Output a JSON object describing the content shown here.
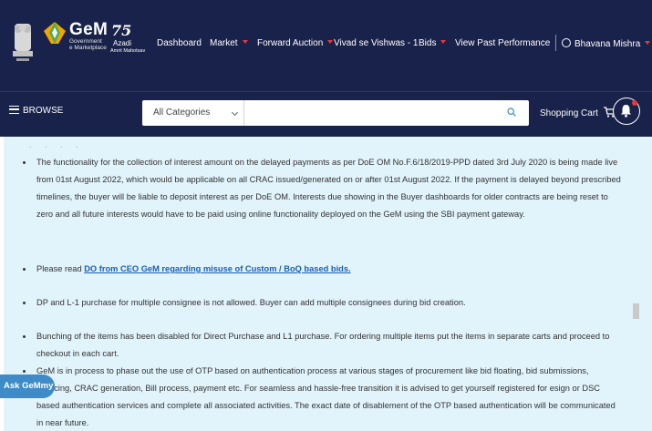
{
  "header": {
    "logo_text": "GeM",
    "logo_subtext_1": "Government",
    "logo_subtext_2": "e Marketplace",
    "azadi_number": "75",
    "azadi_word": "Azadi",
    "azadi_sub": "Amrit Mahotsav",
    "nav": [
      {
        "label": "Dashboard",
        "dropdown": false
      },
      {
        "label": "Market",
        "dropdown": true
      },
      {
        "label": "Forward Auction",
        "dropdown": true
      },
      {
        "label": "Vivad se Vishwas - 1",
        "dropdown": false
      },
      {
        "label": "Bids",
        "dropdown": true
      },
      {
        "label": "View Past Performance",
        "dropdown": false
      }
    ],
    "user_name": "Bhavana Mishra",
    "accent_color": "#e53935",
    "bg_color": "#19224a"
  },
  "toolbar": {
    "browse_label": "BROWSE",
    "category_selected": "All Categories",
    "search_value": "",
    "cart_label": "Shopping Cart"
  },
  "content": {
    "bullets": [
      {
        "text": "The functionality for the collection of interest amount on the delayed payments as per DoE OM No.F.6/18/2019-PPD dated 3rd July 2020 is being made live from 01st August 2022, which would be applicable on all CRAC issued/generated on or after 01st August 2022. If the payment is delayed beyond prescribed timelines, the buyer will be liable to deposit interest as per DoE OM. Interests due showing in the Buyer dashboards for older contracts are being reset to zero and all future interests would have to be paid using online functionality deployed on the GeM using the SBI payment gateway."
      },
      {
        "prefix": "Please read ",
        "link": "DO from CEO GeM regarding misuse of Custom / BoQ based bids."
      },
      {
        "text": "DP and L-1 purchase for multiple consignee is not allowed. Buyer can add multiple consignees during bid creation."
      },
      {
        "text": "Bunching of the items has been disabled for Direct Purchase and L1 purchase. For ordering multiple items put the items in separate carts and proceed to checkout in each cart."
      },
      {
        "text": "GeM is in process to phase out the use of OTP based on authentication process at various stages of procurement like bid floating, bid submissions, invoicing, CRAC generation, Bill process, payment etc. For seamless and hassle-free transition it is advised to get yourself registered for esign or DSC based authentication services and complete all associated activities. The exact date of disablement of the OTP based authentication will be communicated in near future."
      }
    ],
    "bg_color": "#e1f3fb"
  },
  "chat": {
    "label": "Ask GeMmy"
  }
}
